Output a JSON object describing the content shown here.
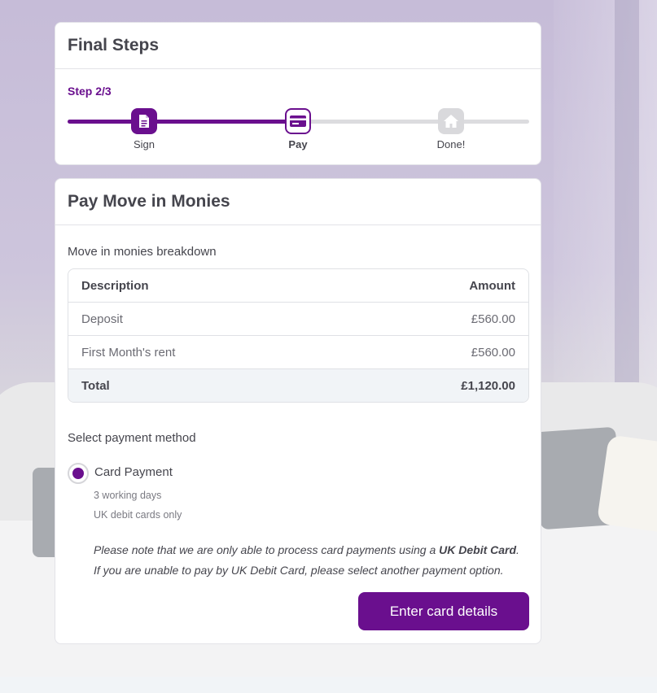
{
  "progress": {
    "title": "Final Steps",
    "step_text": "Step 2/3",
    "completed_fraction": 0.5,
    "steps": [
      {
        "label": "Sign",
        "icon": "document-icon",
        "state": "done"
      },
      {
        "label": "Pay",
        "icon": "card-icon",
        "state": "active"
      },
      {
        "label": "Done!",
        "icon": "home-icon",
        "state": "todo"
      }
    ]
  },
  "payment": {
    "title": "Pay Move in Monies",
    "breakdown_label": "Move in monies breakdown",
    "table": {
      "headers": [
        "Description",
        "Amount"
      ],
      "rows": [
        {
          "description": "Deposit",
          "amount": "£560.00"
        },
        {
          "description": "First Month's rent",
          "amount": "£560.00"
        }
      ],
      "total": {
        "label": "Total",
        "amount": "£1,120.00"
      }
    },
    "method_label": "Select payment method",
    "method": {
      "name": "Card Payment",
      "selected": true,
      "detail_1": "3 working days",
      "detail_2": "UK debit cards only"
    },
    "note_prefix": "Please note that we are only able to process card payments using a ",
    "note_bold": "UK Debit Card",
    "note_suffix": ". If you are unable to pay by UK Debit Card, please select another payment option.",
    "cta_label": "Enter card details"
  },
  "colors": {
    "accent": "#6a0f8e",
    "track": "#dcdcdf",
    "total_row_bg": "#f1f4f7"
  }
}
